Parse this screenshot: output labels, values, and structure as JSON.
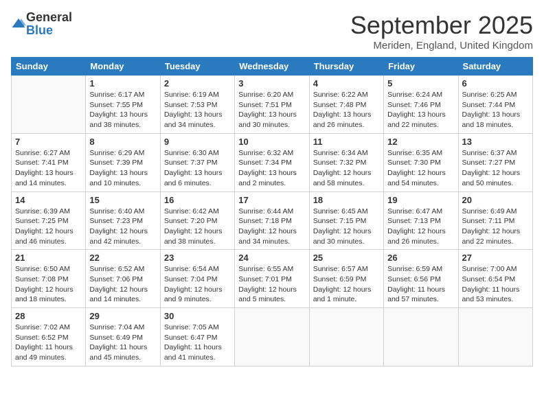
{
  "logo": {
    "general": "General",
    "blue": "Blue"
  },
  "header": {
    "month": "September 2025",
    "location": "Meriden, England, United Kingdom"
  },
  "days_of_week": [
    "Sunday",
    "Monday",
    "Tuesday",
    "Wednesday",
    "Thursday",
    "Friday",
    "Saturday"
  ],
  "weeks": [
    [
      {
        "day": "",
        "info": ""
      },
      {
        "day": "1",
        "info": "Sunrise: 6:17 AM\nSunset: 7:55 PM\nDaylight: 13 hours and 38 minutes."
      },
      {
        "day": "2",
        "info": "Sunrise: 6:19 AM\nSunset: 7:53 PM\nDaylight: 13 hours and 34 minutes."
      },
      {
        "day": "3",
        "info": "Sunrise: 6:20 AM\nSunset: 7:51 PM\nDaylight: 13 hours and 30 minutes."
      },
      {
        "day": "4",
        "info": "Sunrise: 6:22 AM\nSunset: 7:48 PM\nDaylight: 13 hours and 26 minutes."
      },
      {
        "day": "5",
        "info": "Sunrise: 6:24 AM\nSunset: 7:46 PM\nDaylight: 13 hours and 22 minutes."
      },
      {
        "day": "6",
        "info": "Sunrise: 6:25 AM\nSunset: 7:44 PM\nDaylight: 13 hours and 18 minutes."
      }
    ],
    [
      {
        "day": "7",
        "info": "Sunrise: 6:27 AM\nSunset: 7:41 PM\nDaylight: 13 hours and 14 minutes."
      },
      {
        "day": "8",
        "info": "Sunrise: 6:29 AM\nSunset: 7:39 PM\nDaylight: 13 hours and 10 minutes."
      },
      {
        "day": "9",
        "info": "Sunrise: 6:30 AM\nSunset: 7:37 PM\nDaylight: 13 hours and 6 minutes."
      },
      {
        "day": "10",
        "info": "Sunrise: 6:32 AM\nSunset: 7:34 PM\nDaylight: 13 hours and 2 minutes."
      },
      {
        "day": "11",
        "info": "Sunrise: 6:34 AM\nSunset: 7:32 PM\nDaylight: 12 hours and 58 minutes."
      },
      {
        "day": "12",
        "info": "Sunrise: 6:35 AM\nSunset: 7:30 PM\nDaylight: 12 hours and 54 minutes."
      },
      {
        "day": "13",
        "info": "Sunrise: 6:37 AM\nSunset: 7:27 PM\nDaylight: 12 hours and 50 minutes."
      }
    ],
    [
      {
        "day": "14",
        "info": "Sunrise: 6:39 AM\nSunset: 7:25 PM\nDaylight: 12 hours and 46 minutes."
      },
      {
        "day": "15",
        "info": "Sunrise: 6:40 AM\nSunset: 7:23 PM\nDaylight: 12 hours and 42 minutes."
      },
      {
        "day": "16",
        "info": "Sunrise: 6:42 AM\nSunset: 7:20 PM\nDaylight: 12 hours and 38 minutes."
      },
      {
        "day": "17",
        "info": "Sunrise: 6:44 AM\nSunset: 7:18 PM\nDaylight: 12 hours and 34 minutes."
      },
      {
        "day": "18",
        "info": "Sunrise: 6:45 AM\nSunset: 7:15 PM\nDaylight: 12 hours and 30 minutes."
      },
      {
        "day": "19",
        "info": "Sunrise: 6:47 AM\nSunset: 7:13 PM\nDaylight: 12 hours and 26 minutes."
      },
      {
        "day": "20",
        "info": "Sunrise: 6:49 AM\nSunset: 7:11 PM\nDaylight: 12 hours and 22 minutes."
      }
    ],
    [
      {
        "day": "21",
        "info": "Sunrise: 6:50 AM\nSunset: 7:08 PM\nDaylight: 12 hours and 18 minutes."
      },
      {
        "day": "22",
        "info": "Sunrise: 6:52 AM\nSunset: 7:06 PM\nDaylight: 12 hours and 14 minutes."
      },
      {
        "day": "23",
        "info": "Sunrise: 6:54 AM\nSunset: 7:04 PM\nDaylight: 12 hours and 9 minutes."
      },
      {
        "day": "24",
        "info": "Sunrise: 6:55 AM\nSunset: 7:01 PM\nDaylight: 12 hours and 5 minutes."
      },
      {
        "day": "25",
        "info": "Sunrise: 6:57 AM\nSunset: 6:59 PM\nDaylight: 12 hours and 1 minute."
      },
      {
        "day": "26",
        "info": "Sunrise: 6:59 AM\nSunset: 6:56 PM\nDaylight: 11 hours and 57 minutes."
      },
      {
        "day": "27",
        "info": "Sunrise: 7:00 AM\nSunset: 6:54 PM\nDaylight: 11 hours and 53 minutes."
      }
    ],
    [
      {
        "day": "28",
        "info": "Sunrise: 7:02 AM\nSunset: 6:52 PM\nDaylight: 11 hours and 49 minutes."
      },
      {
        "day": "29",
        "info": "Sunrise: 7:04 AM\nSunset: 6:49 PM\nDaylight: 11 hours and 45 minutes."
      },
      {
        "day": "30",
        "info": "Sunrise: 7:05 AM\nSunset: 6:47 PM\nDaylight: 11 hours and 41 minutes."
      },
      {
        "day": "",
        "info": ""
      },
      {
        "day": "",
        "info": ""
      },
      {
        "day": "",
        "info": ""
      },
      {
        "day": "",
        "info": ""
      }
    ]
  ]
}
